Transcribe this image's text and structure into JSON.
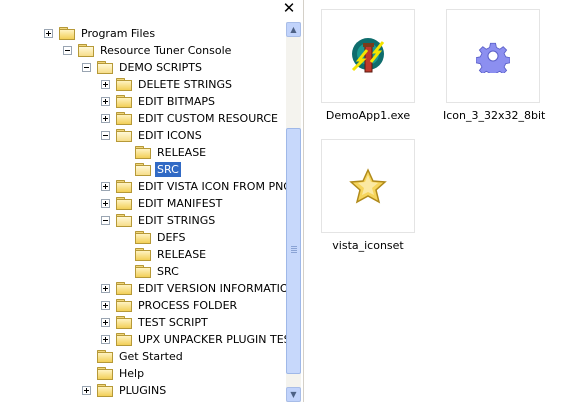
{
  "tree": {
    "close_glyph": "✕",
    "items": [
      {
        "label": "Program Files",
        "state": "plus"
      },
      {
        "label": "Resource Tuner Console",
        "state": "minus"
      },
      {
        "label": "DEMO SCRIPTS",
        "state": "minus"
      },
      {
        "label": "DELETE STRINGS",
        "state": "plus"
      },
      {
        "label": "EDIT BITMAPS",
        "state": "plus"
      },
      {
        "label": "EDIT CUSTOM RESOURCE",
        "state": "plus"
      },
      {
        "label": "EDIT ICONS",
        "state": "minus"
      },
      {
        "label": "RELEASE",
        "state": "none"
      },
      {
        "label": "SRC",
        "state": "none",
        "selected": true
      },
      {
        "label": "EDIT VISTA ICON FROM PNG",
        "state": "plus"
      },
      {
        "label": "EDIT MANIFEST",
        "state": "plus"
      },
      {
        "label": "EDIT STRINGS",
        "state": "minus"
      },
      {
        "label": "DEFS",
        "state": "none"
      },
      {
        "label": "RELEASE",
        "state": "none"
      },
      {
        "label": "SRC",
        "state": "none"
      },
      {
        "label": "EDIT VERSION INFORMATION",
        "state": "plus"
      },
      {
        "label": "PROCESS FOLDER",
        "state": "plus"
      },
      {
        "label": "TEST SCRIPT",
        "state": "plus"
      },
      {
        "label": "UPX UNPACKER PLUGIN TEST",
        "state": "plus"
      },
      {
        "label": "Get Started",
        "state": "none"
      },
      {
        "label": "Help",
        "state": "none"
      },
      {
        "label": "PLUGINS",
        "state": "plus"
      }
    ]
  },
  "scrollbar": {
    "up_glyph": "▲",
    "down_glyph": "▼"
  },
  "files": [
    {
      "label": "DemoApp1.exe",
      "icon": "app-exe-icon"
    },
    {
      "label": "Icon_3_32x32_8bit",
      "icon": "gear-icon"
    },
    {
      "label": "vista_iconset",
      "icon": "star-icon"
    }
  ],
  "colors": {
    "selection": "#316ac5",
    "folder": "#f2cf57",
    "scrollbar": "#c1d3fb"
  }
}
